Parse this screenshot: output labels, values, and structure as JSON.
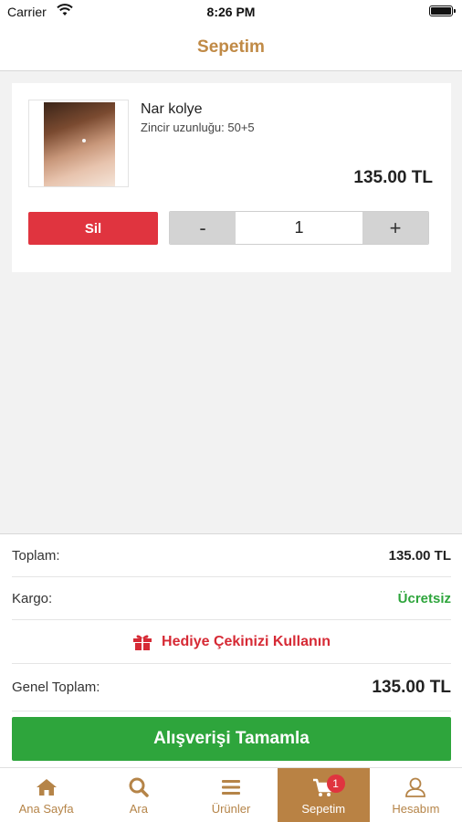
{
  "status_bar": {
    "carrier": "Carrier",
    "time": "8:26 PM"
  },
  "header": {
    "title": "Sepetim"
  },
  "cart": {
    "items": [
      {
        "name": "Nar kolye",
        "variant": "Zincir uzunluğu: 50+5",
        "price": "135.00 TL",
        "remove_label": "Sil",
        "decrease_label": "-",
        "quantity": "1",
        "increase_label": "+"
      }
    ]
  },
  "summary": {
    "subtotal_label": "Toplam:",
    "subtotal_value": "135.00 TL",
    "shipping_label": "Kargo:",
    "shipping_value": "Ücretsiz",
    "gift_card_label": "Hediye Çekinizi Kullanın",
    "grand_total_label": "Genel Toplam:",
    "grand_total_value": "135.00 TL",
    "checkout_label": "Alışverişi Tamamla"
  },
  "tab_bar": {
    "tabs": [
      {
        "label": "Ana Sayfa",
        "icon": "home-icon"
      },
      {
        "label": "Ara",
        "icon": "search-icon"
      },
      {
        "label": "Ürünler",
        "icon": "menu-icon"
      },
      {
        "label": "Sepetim",
        "icon": "cart-icon",
        "badge": "1",
        "active": true
      },
      {
        "label": "Hesabım",
        "icon": "user-icon"
      }
    ]
  },
  "colors": {
    "brand": "#c08a46",
    "active_tab": "#b98244",
    "danger": "#e0343f",
    "success": "#2ea53c"
  }
}
